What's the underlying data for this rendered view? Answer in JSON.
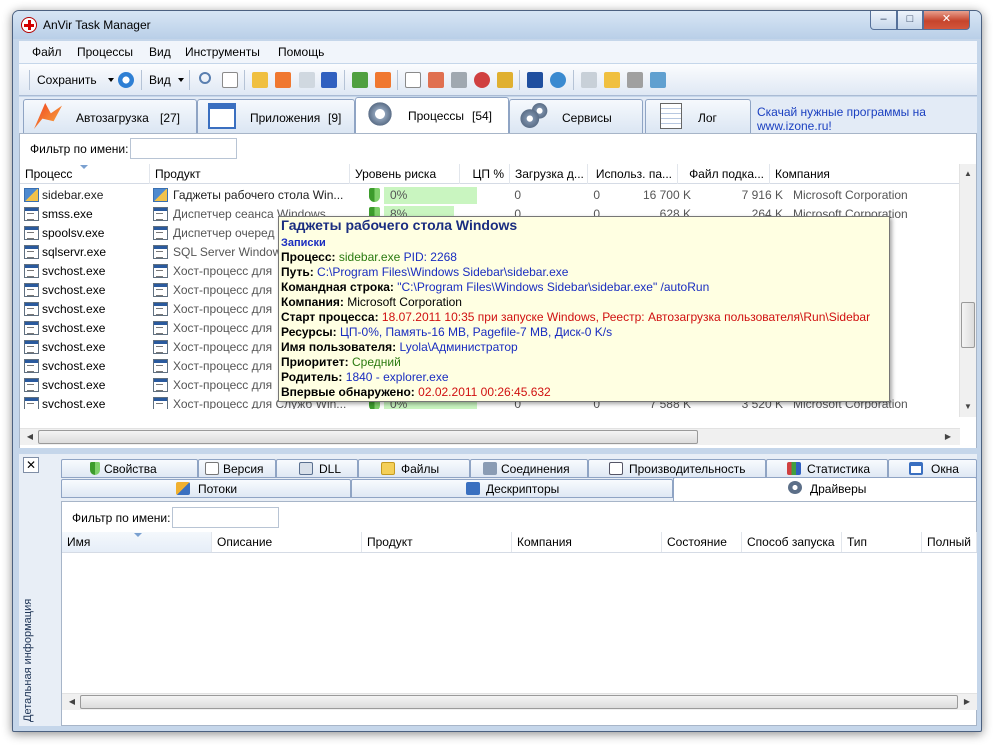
{
  "window": {
    "title": "AnVir Task Manager",
    "min_glyph": "–",
    "max_glyph": "□",
    "close_glyph": "✕"
  },
  "menu": {
    "items": [
      "Файл",
      "Процессы",
      "Вид",
      "Инструменты",
      "Помощь"
    ]
  },
  "toolbar": {
    "save_label": "Сохранить",
    "view_label": "Вид"
  },
  "main_tabs": [
    {
      "label": "Автозагрузка",
      "count": "[27]",
      "icon": "rocket-icon"
    },
    {
      "label": "Приложения",
      "count": "[9]",
      "icon": "window-icon"
    },
    {
      "label": "Процессы",
      "count": "[54]",
      "icon": "gear-icon"
    },
    {
      "label": "Сервисы",
      "count": "",
      "icon": "gears-icon"
    },
    {
      "label": "Лог",
      "count": "",
      "icon": "notepad-icon"
    }
  ],
  "ad": {
    "line1": "Скачай нужные программы на",
    "line2": "www.izone.ru!"
  },
  "filter": {
    "label": "Фильтр по имени:",
    "value": ""
  },
  "process_columns": [
    "Процесс",
    "Продукт",
    "Уровень риска",
    "ЦП %",
    "Загрузка д...",
    "Использ. па...",
    "Файл подка...",
    "Компания"
  ],
  "processes": [
    {
      "name": "sidebar.exe",
      "product": "Гаджеты рабочего стола Win...",
      "risk": "0%",
      "cpu": "0",
      "disk": "0",
      "mem": "16 700 K",
      "page": "7 916 K",
      "company": "Microsoft Corporation"
    },
    {
      "name": "smss.exe",
      "product": "Диспетчер сеанса  Windows",
      "risk": "8%",
      "cpu": "0",
      "disk": "0",
      "mem": "628 K",
      "page": "264 K",
      "company": "Microsoft Corporation"
    },
    {
      "name": "spoolsv.exe",
      "product": "Диспетчер очеред",
      "risk": "",
      "cpu": "",
      "disk": "",
      "mem": "",
      "page": "",
      "company": ""
    },
    {
      "name": "sqlservr.exe",
      "product": "SQL Server Window",
      "risk": "",
      "cpu": "",
      "disk": "",
      "mem": "",
      "page": "",
      "company": ""
    },
    {
      "name": "svchost.exe",
      "product": "Хост-процесс для",
      "risk": "",
      "cpu": "",
      "disk": "",
      "mem": "",
      "page": "",
      "company": ""
    },
    {
      "name": "svchost.exe",
      "product": "Хост-процесс для",
      "risk": "",
      "cpu": "",
      "disk": "",
      "mem": "",
      "page": "",
      "company": ""
    },
    {
      "name": "svchost.exe",
      "product": "Хост-процесс для",
      "risk": "",
      "cpu": "",
      "disk": "",
      "mem": "",
      "page": "",
      "company": ""
    },
    {
      "name": "svchost.exe",
      "product": "Хост-процесс для",
      "risk": "",
      "cpu": "",
      "disk": "",
      "mem": "",
      "page": "",
      "company": ""
    },
    {
      "name": "svchost.exe",
      "product": "Хост-процесс для",
      "risk": "",
      "cpu": "",
      "disk": "",
      "mem": "",
      "page": "",
      "company": ""
    },
    {
      "name": "svchost.exe",
      "product": "Хост-процесс для",
      "risk": "",
      "cpu": "",
      "disk": "",
      "mem": "",
      "page": "",
      "company": ""
    },
    {
      "name": "svchost.exe",
      "product": "Хост-процесс для",
      "risk": "",
      "cpu": "",
      "disk": "",
      "mem": "",
      "page": "",
      "company": ""
    },
    {
      "name": "svchost.exe",
      "product": "Хост-процесс для Служб Win...",
      "risk": "0%",
      "cpu": "0",
      "disk": "0",
      "mem": "7 588 K",
      "page": "3 520 K",
      "company": "Microsoft Corporation"
    }
  ],
  "tooltip": {
    "title": "Гаджеты рабочего стола Windows",
    "notes": "Записки",
    "process_key": "Процесс:",
    "process_name": "sidebar.exe",
    "pid": "PID: 2268",
    "path_key": "Путь:",
    "path": "C:\\Program Files\\Windows Sidebar\\sidebar.exe",
    "cmd_key": "Командная строка:",
    "cmd": "\"C:\\Program Files\\Windows Sidebar\\sidebar.exe\" /autoRun",
    "company_key": "Компания:",
    "company": "Microsoft Corporation",
    "start_key": "Старт процесса:",
    "start": "18.07.2011 10:35 при запуске Windows, Реестр: Автозагрузка пользователя\\Run\\Sidebar",
    "res_key": "Ресурсы:",
    "res": "ЦП-0%, Память-16 MB, Pagefile-7 MB, Диск-0 K/s",
    "user_key": "Имя пользователя:",
    "user": "Lyola\\Администратор",
    "prio_key": "Приоритет:",
    "prio": "Средний",
    "parent_key": "Родитель:",
    "parent": "1840 - explorer.exe",
    "first_key": "Впервые обнаружено:",
    "first": "02.02.2011 00:26:45.632"
  },
  "details": {
    "side_label": "Детальная информация",
    "close_glyph": "✕",
    "tabs_row1": [
      "Свойства",
      "Версия",
      "DLL",
      "Файлы",
      "Соединения",
      "Производительность",
      "Статистика",
      "Окна"
    ],
    "tabs_row2": [
      "Потоки",
      "Дескрипторы",
      "Драйверы"
    ],
    "filter_label": "Фильтр по имени:",
    "columns": [
      "Имя",
      "Описание",
      "Продукт",
      "Компания",
      "Состояние",
      "Способ запуска",
      "Тип",
      "Полный"
    ]
  },
  "colors": {
    "accent": "#1a3fc0",
    "risk_low": "#c9f5c0",
    "tooltip_bg": "#ffffe2"
  }
}
